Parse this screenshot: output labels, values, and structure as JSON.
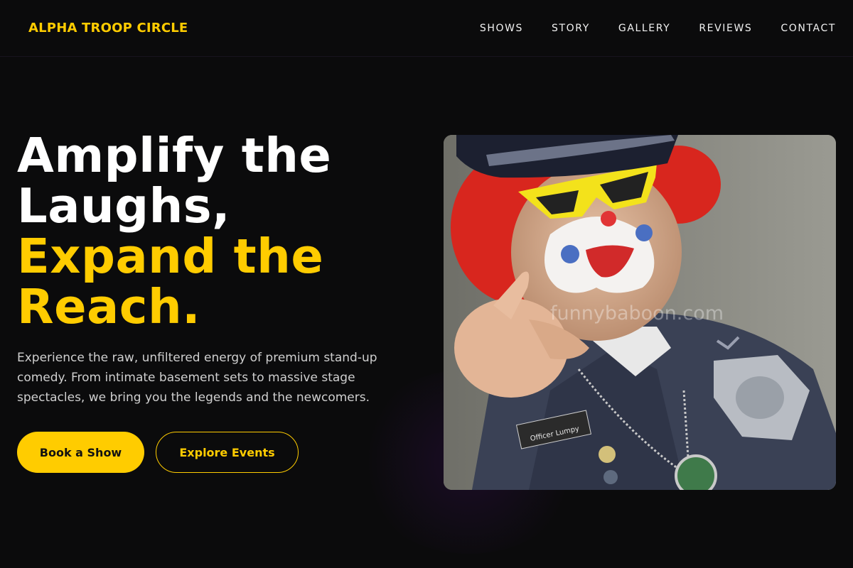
{
  "brand": "ALPHA TROOP CIRCLE",
  "nav": {
    "items": [
      {
        "label": "SHOWS"
      },
      {
        "label": "STORY"
      },
      {
        "label": "GALLERY"
      },
      {
        "label": "REVIEWS"
      },
      {
        "label": "CONTACT"
      }
    ]
  },
  "hero": {
    "headline_line1": "Amplify the",
    "headline_line2": "Laughs,",
    "headline_line3": "Expand the",
    "headline_line4": "Reach.",
    "description": "Experience the raw, unfiltered energy of premium stand-up comedy. From intimate basement sets to massive stage spectacles, we bring you the legends and the newcomers.",
    "primary_button": "Book a Show",
    "secondary_button": "Explore Events"
  },
  "photo": {
    "watermark": "funnybaboon.com",
    "name_tag": "Officer Lumpy"
  },
  "colors": {
    "accent": "#ffcc00",
    "background": "#0b0b0c",
    "text": "#ffffff"
  }
}
